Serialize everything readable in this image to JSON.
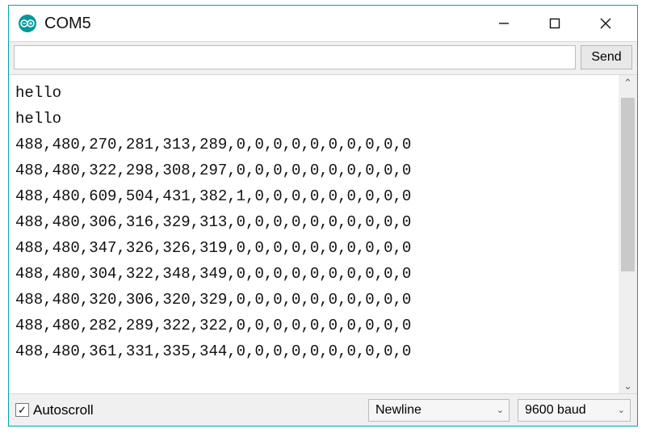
{
  "titlebar": {
    "title": "COM5"
  },
  "input_row": {
    "serial_value": "",
    "serial_placeholder": "",
    "send_label": "Send"
  },
  "output_lines": [
    "hello",
    "hello",
    "488,480,270,281,313,289,0,0,0,0,0,0,0,0,0,0",
    "488,480,322,298,308,297,0,0,0,0,0,0,0,0,0,0",
    "488,480,609,504,431,382,1,0,0,0,0,0,0,0,0,0",
    "488,480,306,316,329,313,0,0,0,0,0,0,0,0,0,0",
    "488,480,347,326,326,319,0,0,0,0,0,0,0,0,0,0",
    "488,480,304,322,348,349,0,0,0,0,0,0,0,0,0,0",
    "488,480,320,306,320,329,0,0,0,0,0,0,0,0,0,0",
    "488,480,282,289,322,322,0,0,0,0,0,0,0,0,0,0",
    "488,480,361,331,335,344,0,0,0,0,0,0,0,0,0,0"
  ],
  "footer": {
    "autoscroll_label": "Autoscroll",
    "autoscroll_checked": true,
    "line_ending_value": "Newline",
    "baud_value": "9600 baud"
  },
  "icons": {
    "checkmark": "✓",
    "chevron_down": "⌄",
    "scroll_up": "⌃",
    "scroll_down": "⌄"
  }
}
